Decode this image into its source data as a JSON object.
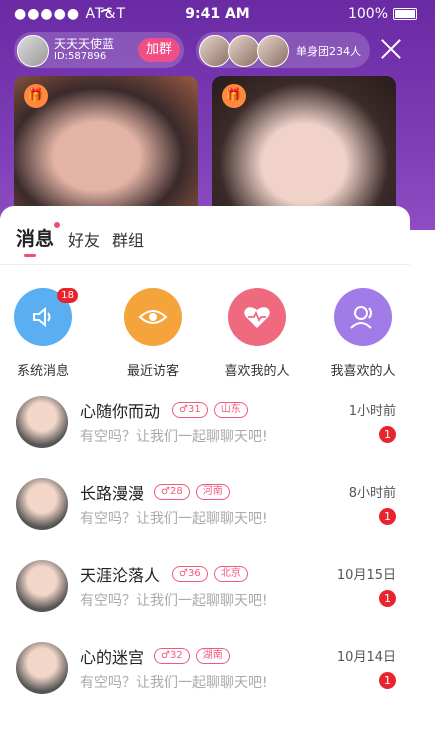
{
  "status": {
    "carrier": "●●●●● AT&T",
    "time": "9:41 AM",
    "battery": "100%"
  },
  "host": {
    "name": "天天天使蓝",
    "id": "ID:587896",
    "join_label": "加群"
  },
  "group": {
    "label": "单身团234人"
  },
  "sheet": {
    "tabs": [
      {
        "label": "消息"
      },
      {
        "label": "好友"
      },
      {
        "label": "群组"
      }
    ],
    "shortcuts": [
      {
        "label": "系统消息",
        "badge": "18",
        "color": "#5aaef2"
      },
      {
        "label": "最近访客",
        "color": "#f5a43c"
      },
      {
        "label": "喜欢我的人",
        "color": "#f06a7f"
      },
      {
        "label": "我喜欢的人",
        "color": "#a17ce8"
      }
    ],
    "messages": [
      {
        "name": "心随你而动",
        "gender_age": "♂31",
        "city": "山东",
        "preview": "有空吗？让我们一起聊聊天吧!",
        "time": "1小时前",
        "unread": "1"
      },
      {
        "name": "长路漫漫",
        "gender_age": "♂28",
        "city": "河南",
        "preview": "有空吗？让我们一起聊聊天吧!",
        "time": "8小时前",
        "unread": "1"
      },
      {
        "name": "天涯沦落人",
        "gender_age": "♂36",
        "city": "北京",
        "preview": "有空吗？让我们一起聊聊天吧!",
        "time": "10月15日",
        "unread": "1"
      },
      {
        "name": "心的迷宫",
        "gender_age": "♂32",
        "city": "湖南",
        "preview": "有空吗？让我们一起聊聊天吧!",
        "time": "10月14日",
        "unread": "1"
      }
    ]
  }
}
